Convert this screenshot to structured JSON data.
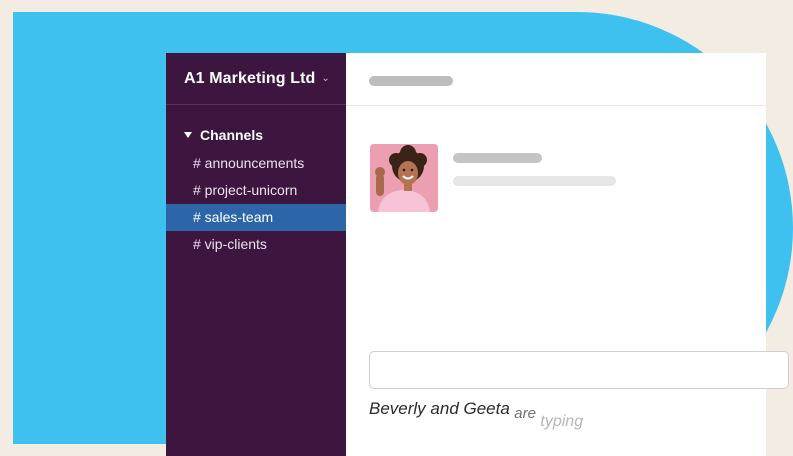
{
  "workspace": {
    "name": "A1 Marketing Ltd",
    "chevron_icon": "chevron-down-icon"
  },
  "sidebar": {
    "section_label": "Channels",
    "caret_icon": "caret-down-icon",
    "channels": [
      {
        "label": "# announcements",
        "active": false
      },
      {
        "label": "# project-unicorn",
        "active": false
      },
      {
        "label": "# sales-team",
        "active": true
      },
      {
        "label": "# vip-clients",
        "active": false
      }
    ]
  },
  "message": {
    "avatar": "avatar-image"
  },
  "composer": {
    "value": ""
  },
  "typing": {
    "who": "Beverly and Geeta",
    "are": "are",
    "typing": "typing"
  },
  "colors": {
    "background": "#f3ece3",
    "blue_panel": "#3ec1ef",
    "sidebar": "#3d1640",
    "active_channel": "#2c66a8"
  }
}
